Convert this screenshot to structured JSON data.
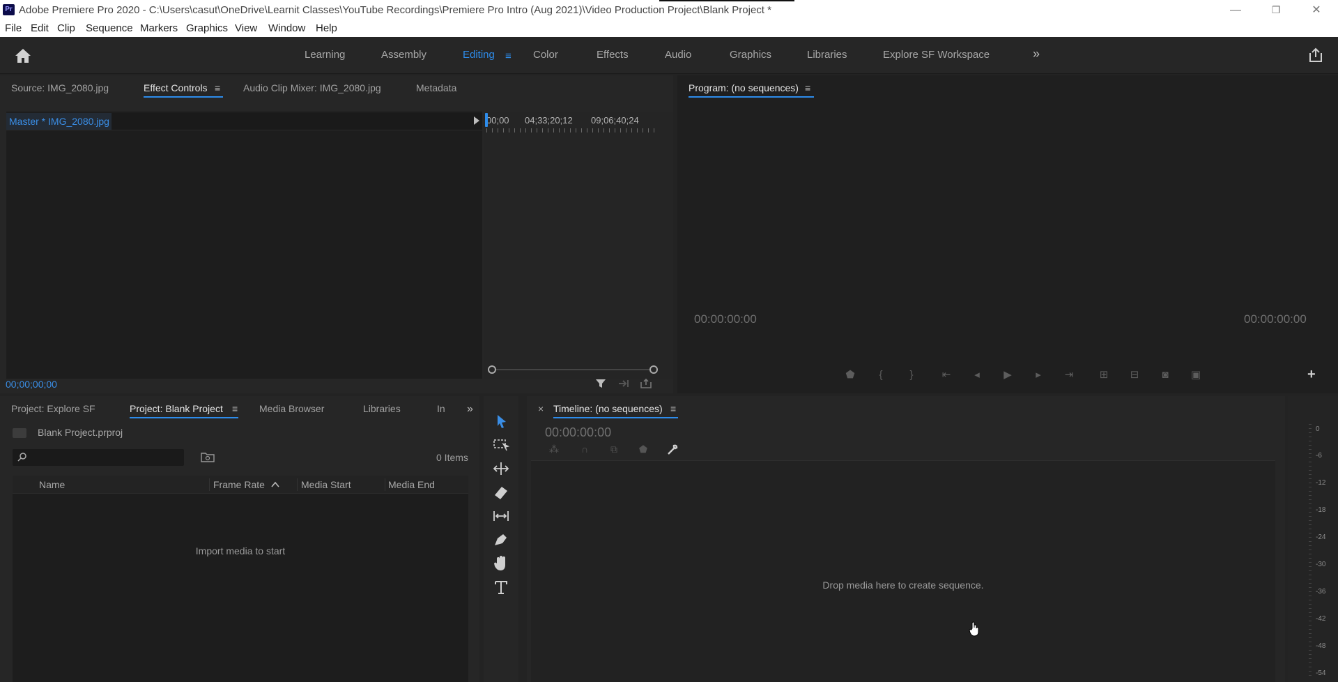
{
  "titlebar": {
    "logo": "Pr",
    "title": "Adobe Premiere Pro 2020 - C:\\Users\\casut\\OneDrive\\Learnit Classes\\YouTube Recordings\\Premiere Pro Intro (Aug 2021)\\Video Production Project\\Blank Project *",
    "minimize": "—",
    "restore": "❐",
    "close": "✕"
  },
  "menu": [
    "File",
    "Edit",
    "Clip",
    "Sequence",
    "Markers",
    "Graphics",
    "View",
    "Window",
    "Help"
  ],
  "workspaces": {
    "tabs": [
      "Learning",
      "Assembly",
      "Editing",
      "Color",
      "Effects",
      "Audio",
      "Graphics",
      "Libraries",
      "Explore SF Workspace"
    ],
    "active": "Editing",
    "more_glyph": "»"
  },
  "effect_controls": {
    "tabs": [
      "Source: IMG_2080.jpg",
      "Effect Controls",
      "Audio Clip Mixer: IMG_2080.jpg",
      "Metadata"
    ],
    "active_tab": "Effect Controls",
    "master_label": "Master * IMG_2080.jpg",
    "ruler": [
      "00;00",
      "04;33;20;12",
      "09;06;40;24"
    ],
    "current_time": "00;00;00;00"
  },
  "program": {
    "title": "Program: (no sequences)",
    "timecode_left": "00:00:00:00",
    "timecode_right": "00:00:00:00",
    "add_glyph": "+"
  },
  "project": {
    "tabs": [
      "Project: Explore SF",
      "Project: Blank Project",
      "Media Browser",
      "Libraries",
      "In"
    ],
    "active_tab": "Project: Blank Project",
    "file": "Blank Project.prproj",
    "search_value": "",
    "items": "0 Items",
    "columns": [
      "Name",
      "Frame Rate",
      "Media Start",
      "Media End"
    ],
    "empty_message": "Import media to start"
  },
  "timeline": {
    "close": "×",
    "title": "Timeline: (no sequences)",
    "timecode": "00:00:00:00",
    "drop_message": "Drop media here to create sequence."
  },
  "audio_meter": {
    "levels": [
      "0",
      "-6",
      "-12",
      "-18",
      "-24",
      "-30",
      "-36",
      "-42",
      "-48",
      "-54"
    ]
  },
  "colors": {
    "accent": "#2d8ceb",
    "panel": "#1e1e1e",
    "background": "#232323"
  }
}
